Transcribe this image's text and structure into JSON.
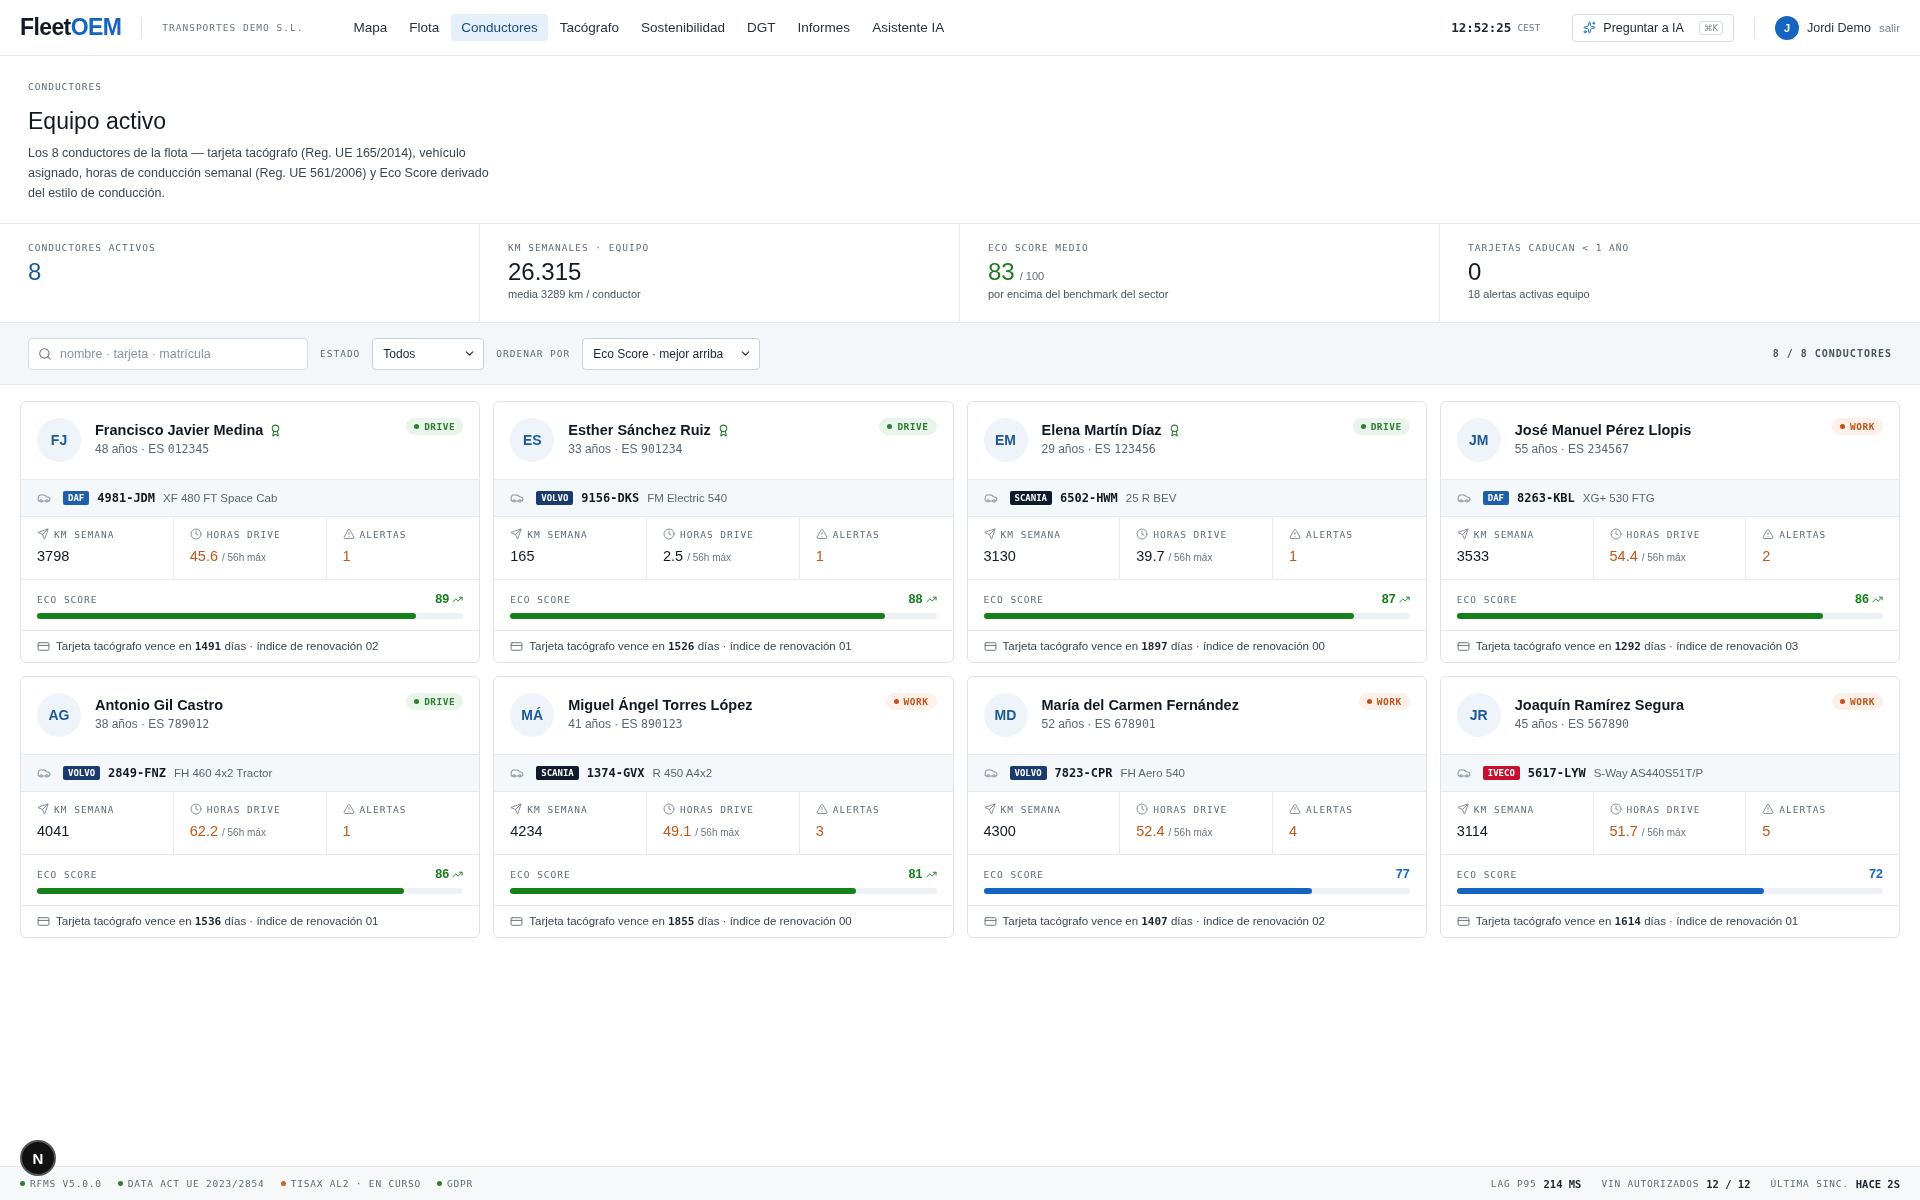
{
  "header": {
    "logo": {
      "lead": "Fleet",
      "accent": "OEM"
    },
    "company": "TRANSPORTES DEMO S.L.",
    "nav": [
      {
        "label": "Mapa",
        "selected": false
      },
      {
        "label": "Flota",
        "selected": false
      },
      {
        "label": "Conductores",
        "selected": true
      },
      {
        "label": "Tacógrafo",
        "selected": false
      },
      {
        "label": "Sostenibilidad",
        "selected": false
      },
      {
        "label": "DGT",
        "selected": false
      },
      {
        "label": "Informes",
        "selected": false
      },
      {
        "label": "Asistente IA",
        "selected": false
      }
    ],
    "clock": {
      "time": "12:52:25",
      "zone": "CEST"
    },
    "ask_button": {
      "label": "Preguntar a IA",
      "shortcut": "⌘K"
    },
    "user": {
      "initial": "J",
      "name": "Jordi Demo",
      "logout": "salir"
    }
  },
  "hero": {
    "eyebrow": "CONDUCTORES",
    "title": "Equipo activo",
    "description": "Los 8 conductores de la flota — tarjeta tacógrafo (Reg. UE 165/2014), vehículo asignado, horas de conducción semanal (Reg. UE 561/2006) y Eco Score derivado del estilo de conducción."
  },
  "kpis": [
    {
      "label": "CONDUCTORES ACTIVOS",
      "value": "8",
      "kind": "accent"
    },
    {
      "label": "KM SEMANALES · EQUIPO",
      "value": "26.315",
      "note": "media 3289 km / conductor",
      "kind": "plain"
    },
    {
      "label": "ECO SCORE MEDIO",
      "value": "83",
      "unit": "/ 100",
      "note": "por encima del benchmark del sector",
      "kind": "good"
    },
    {
      "label": "TARJETAS CADUCAN < 1 AÑO",
      "value": "0",
      "note": "18 alertas activas equipo",
      "kind": "plain"
    }
  ],
  "filters": {
    "search": {
      "placeholder": "nombre · tarjeta · matrícula"
    },
    "status": {
      "label": "ESTADO",
      "value": "Todos"
    },
    "sort": {
      "label": "ORDENAR POR",
      "value": "Eco Score · mejor arriba"
    },
    "count": "8 / 8 CONDUCTORES"
  },
  "drivers": [
    {
      "initials": "FJ",
      "name": "Francisco Javier Medina",
      "award": true,
      "meta": "48 años · ES",
      "licence": "012345",
      "status": {
        "label": "DRIVE",
        "kind": "drive"
      },
      "vehicle": {
        "brand": "DAF",
        "color": "#1f5ea8",
        "plate": "4981-JDM",
        "model": "XF 480 FT Space Cab"
      },
      "stats": [
        {
          "kind": "km",
          "label": "KM SEMANA",
          "value": "3798"
        },
        {
          "kind": "hours",
          "label": "HORAS DRIVE",
          "value": "45.6",
          "limit": "/ 56h máx",
          "warning": true
        },
        {
          "kind": "alerts",
          "label": "ALERTAS",
          "value": "1"
        }
      ],
      "eco": {
        "label": "ECO SCORE",
        "score": "89",
        "level": 0.89,
        "kind": "good",
        "trend": true
      },
      "card_note": "Tarjeta tacógrafo vence en **1491** días · índice de renovación 02"
    },
    {
      "initials": "ES",
      "name": "Esther Sánchez Ruiz",
      "award": true,
      "meta": "33 años · ES",
      "licence": "901234",
      "status": {
        "label": "DRIVE",
        "kind": "drive"
      },
      "vehicle": {
        "brand": "VOLVO",
        "color": "#1b3a6e",
        "plate": "9156-DKS",
        "model": "FM Electric 540"
      },
      "stats": [
        {
          "kind": "km",
          "label": "KM SEMANA",
          "value": "165"
        },
        {
          "kind": "hours",
          "label": "HORAS DRIVE",
          "value": "2.5",
          "limit": "/ 56h máx",
          "warning": false
        },
        {
          "kind": "alerts",
          "label": "ALERTAS",
          "value": "1"
        }
      ],
      "eco": {
        "label": "ECO SCORE",
        "score": "88",
        "level": 0.88,
        "kind": "good",
        "trend": true
      },
      "card_note": "Tarjeta tacógrafo vence en **1526** días · índice de renovación 01"
    },
    {
      "initials": "EM",
      "name": "Elena Martín Díaz",
      "award": true,
      "meta": "29 años · ES",
      "licence": "123456",
      "status": {
        "label": "DRIVE",
        "kind": "drive"
      },
      "vehicle": {
        "brand": "SCANIA",
        "color": "#0f1a2b",
        "plate": "6502-HWM",
        "model": "25 R BEV"
      },
      "stats": [
        {
          "kind": "km",
          "label": "KM SEMANA",
          "value": "3130"
        },
        {
          "kind": "hours",
          "label": "HORAS DRIVE",
          "value": "39.7",
          "limit": "/ 56h máx",
          "warning": false
        },
        {
          "kind": "alerts",
          "label": "ALERTAS",
          "value": "1"
        }
      ],
      "eco": {
        "label": "ECO SCORE",
        "score": "87",
        "level": 0.87,
        "kind": "good",
        "trend": true
      },
      "card_note": "Tarjeta tacógrafo vence en **1897** días · índice de renovación 00"
    },
    {
      "initials": "JM",
      "name": "José Manuel Pérez Llopis",
      "award": false,
      "meta": "55 años · ES",
      "licence": "234567",
      "status": {
        "label": "WORK",
        "kind": "work"
      },
      "vehicle": {
        "brand": "DAF",
        "color": "#1f5ea8",
        "plate": "8263-KBL",
        "model": "XG+ 530 FTG"
      },
      "stats": [
        {
          "kind": "km",
          "label": "KM SEMANA",
          "value": "3533"
        },
        {
          "kind": "hours",
          "label": "HORAS DRIVE",
          "value": "54.4",
          "limit": "/ 56h máx",
          "warning": true
        },
        {
          "kind": "alerts",
          "label": "ALERTAS",
          "value": "2"
        }
      ],
      "eco": {
        "label": "ECO SCORE",
        "score": "86",
        "level": 0.86,
        "kind": "good",
        "trend": true
      },
      "card_note": "Tarjeta tacógrafo vence en **1292** días · índice de renovación 03"
    },
    {
      "initials": "AG",
      "name": "Antonio Gil Castro",
      "award": false,
      "meta": "38 años · ES",
      "licence": "789012",
      "status": {
        "label": "DRIVE",
        "kind": "drive"
      },
      "vehicle": {
        "brand": "VOLVO",
        "color": "#1b3a6e",
        "plate": "2849-FNZ",
        "model": "FH 460 4x2 Tractor"
      },
      "stats": [
        {
          "kind": "km",
          "label": "KM SEMANA",
          "value": "4041"
        },
        {
          "kind": "hours",
          "label": "HORAS DRIVE",
          "value": "62.2",
          "limit": "/ 56h máx",
          "warning": true
        },
        {
          "kind": "alerts",
          "label": "ALERTAS",
          "value": "1"
        }
      ],
      "eco": {
        "label": "ECO SCORE",
        "score": "86",
        "level": 0.86,
        "kind": "good",
        "trend": true
      },
      "card_note": "Tarjeta tacógrafo vence en **1536** días · índice de renovación 01"
    },
    {
      "initials": "MÁ",
      "name": "Miguel Ángel Torres López",
      "award": false,
      "meta": "41 años · ES",
      "licence": "890123",
      "status": {
        "label": "WORK",
        "kind": "work"
      },
      "vehicle": {
        "brand": "SCANIA",
        "color": "#0f1a2b",
        "plate": "1374-GVX",
        "model": "R 450 A4x2"
      },
      "stats": [
        {
          "kind": "km",
          "label": "KM SEMANA",
          "value": "4234"
        },
        {
          "kind": "hours",
          "label": "HORAS DRIVE",
          "value": "49.1",
          "limit": "/ 56h máx",
          "warning": true
        },
        {
          "kind": "alerts",
          "label": "ALERTAS",
          "value": "3"
        }
      ],
      "eco": {
        "label": "ECO SCORE",
        "score": "81",
        "level": 0.81,
        "kind": "good",
        "trend": true
      },
      "card_note": "Tarjeta tacógrafo vence en **1855** días · índice de renovación 00"
    },
    {
      "initials": "MD",
      "name": "María del Carmen Fernández",
      "award": false,
      "meta": "52 años · ES",
      "licence": "678901",
      "status": {
        "label": "WORK",
        "kind": "work"
      },
      "vehicle": {
        "brand": "VOLVO",
        "color": "#1b3a6e",
        "plate": "7823-CPR",
        "model": "FH Aero 540"
      },
      "stats": [
        {
          "kind": "km",
          "label": "KM SEMANA",
          "value": "4300"
        },
        {
          "kind": "hours",
          "label": "HORAS DRIVE",
          "value": "52.4",
          "limit": "/ 56h máx",
          "warning": true
        },
        {
          "kind": "alerts",
          "label": "ALERTAS",
          "value": "4"
        }
      ],
      "eco": {
        "label": "ECO SCORE",
        "score": "77",
        "level": 0.77,
        "kind": "fair",
        "trend": false
      },
      "card_note": "Tarjeta tacógrafo vence en **1407** días · índice de renovación 02"
    },
    {
      "initials": "JR",
      "name": "Joaquín Ramírez Segura",
      "award": false,
      "meta": "45 años · ES",
      "licence": "567890",
      "status": {
        "label": "WORK",
        "kind": "work"
      },
      "vehicle": {
        "brand": "IVECO",
        "color": "#c8102e",
        "plate": "5617-LYW",
        "model": "S-Way AS440S51T/P"
      },
      "stats": [
        {
          "kind": "km",
          "label": "KM SEMANA",
          "value": "3114"
        },
        {
          "kind": "hours",
          "label": "HORAS DRIVE",
          "value": "51.7",
          "limit": "/ 56h máx",
          "warning": true
        },
        {
          "kind": "alerts",
          "label": "ALERTAS",
          "value": "5"
        }
      ],
      "eco": {
        "label": "ECO SCORE",
        "score": "72",
        "level": 0.72,
        "kind": "fair",
        "trend": false
      },
      "card_note": "Tarjeta tacógrafo vence en **1614** días · índice de renovación 01"
    }
  ],
  "status_bar": {
    "items": [
      {
        "label": "RFMS V5.0.0",
        "color": "#2e7d32"
      },
      {
        "label": "DATA ACT UE 2023/2854",
        "color": "#2e7d32"
      },
      {
        "label": "TISAX AL2 · EN CURSO",
        "color": "#d0661f"
      },
      {
        "label": "GDPR",
        "color": "#2e7d32"
      }
    ],
    "stats": [
      {
        "label": "LAG P95",
        "value": "214 MS"
      },
      {
        "label": "VIN AUTORIZADOS",
        "value": "12 / 12"
      },
      {
        "label": "ÚLTIMA SINC.",
        "value": "HACE 2S"
      }
    ]
  },
  "dev_indicator": {
    "label": "N"
  }
}
